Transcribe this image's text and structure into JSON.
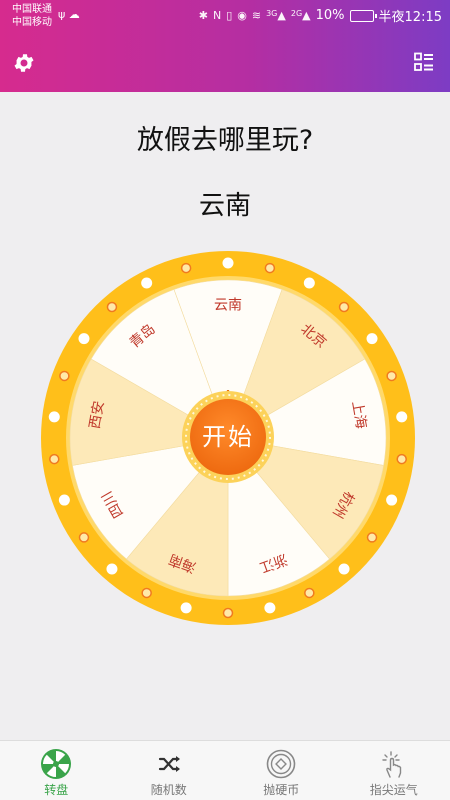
{
  "status_bar": {
    "carrier_1": "中国联通",
    "carrier_2": "中国移动",
    "signal_label_1": "3G",
    "signal_label_2": "2G",
    "battery": "10%",
    "time": "半夜12:15"
  },
  "app_bar": {
    "settings_icon": "gear-icon",
    "menu_icon": "list-icon"
  },
  "question": "放假去哪里玩?",
  "result": "云南",
  "wheel": {
    "segments": [
      "云南",
      "北京",
      "上海",
      "杭州",
      "浙江",
      "海南",
      "四川",
      "西安",
      "青岛"
    ],
    "colors": {
      "light": "#fffdf8",
      "dark": "#fde9b8",
      "rim": "#ffbf1a",
      "text": "#c0392b",
      "center": "#f17a1d"
    },
    "spin_label": "开始"
  },
  "bottom_nav": [
    {
      "label": "转盘",
      "icon": "wheel-icon",
      "active": true
    },
    {
      "label": "随机数",
      "icon": "shuffle-icon",
      "active": false
    },
    {
      "label": "抛硬币",
      "icon": "coin-icon",
      "active": false
    },
    {
      "label": "指尖运气",
      "icon": "finger-tap-icon",
      "active": false
    }
  ]
}
